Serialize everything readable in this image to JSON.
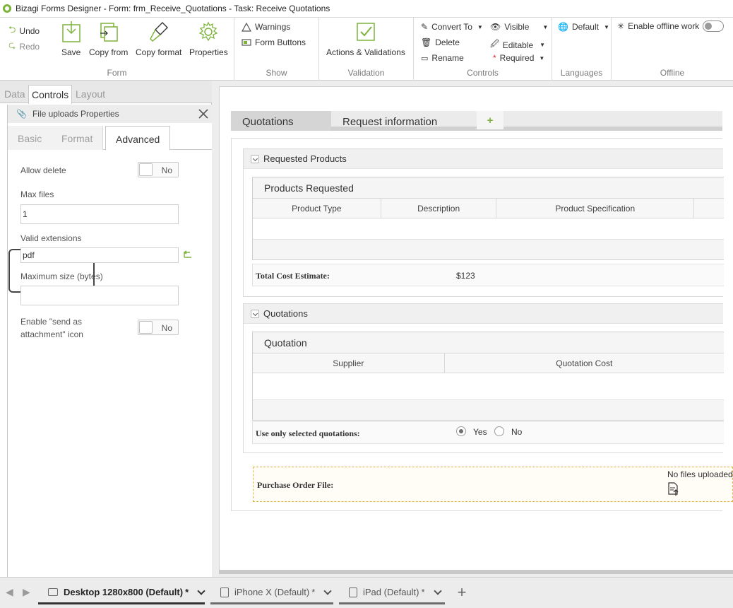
{
  "window": {
    "title": "Bizagi Forms Designer  - Form: frm_Receive_Quotations - Task:  Receive Quotations"
  },
  "ribbon": {
    "undo": "Undo",
    "redo": "Redo",
    "save": "Save",
    "copy_from": "Copy from",
    "copy_format": "Copy format",
    "properties": "Properties",
    "group_form": "Form",
    "warnings": "Warnings",
    "form_buttons": "Form Buttons",
    "group_show": "Show",
    "actions_validations": "Actions & Validations",
    "group_validation": "Validation",
    "convert_to": "Convert To",
    "delete": "Delete",
    "rename": "Rename",
    "visible": "Visible",
    "editable": "Editable",
    "required": "Required",
    "group_controls": "Controls",
    "default_lang": "Default",
    "group_languages": "Languages",
    "enable_offline": "Enable offline work",
    "group_offline": "Offline",
    "accent_color": "#7db33b"
  },
  "left_tabs": [
    "Data",
    "Controls",
    "Layout"
  ],
  "properties_panel": {
    "title": "File uploads Properties",
    "tabs": [
      "Basic",
      "Format",
      "Advanced"
    ],
    "allow_delete": {
      "label": "Allow delete",
      "value": "No"
    },
    "max_files": {
      "label": "Max files",
      "value": "1"
    },
    "valid_extensions": {
      "label": "Valid extensions",
      "value": "pdf"
    },
    "max_size": {
      "label": "Maximum size (bytes)",
      "value": ""
    },
    "send_attachment": {
      "label_line1": "Enable \"send as",
      "label_line2": "attachment\" icon",
      "value": "No"
    }
  },
  "form": {
    "tabs": [
      "Quotations",
      "Request information"
    ],
    "requested_products": {
      "section_title": "Requested Products",
      "grid_title": "Products Requested",
      "columns": [
        "Product Type",
        "Description",
        "Product Specification"
      ],
      "total_label": "Total Cost Estimate:",
      "total_value": "$123"
    },
    "quotations": {
      "section_title": "Quotations",
      "grid_title": "Quotation",
      "columns": [
        "Supplier",
        "Quotation Cost"
      ],
      "selected_label": "Use only selected quotations:",
      "yes": "Yes",
      "no": "No"
    },
    "purchase_order": {
      "label": "Purchase Order File:",
      "status": "No files uploaded"
    }
  },
  "devices": [
    {
      "label": "Desktop 1280x800 (Default)",
      "modified": "*"
    },
    {
      "label": "iPhone X (Default)",
      "modified": "*"
    },
    {
      "label": "iPad (Default)",
      "modified": "*"
    }
  ]
}
